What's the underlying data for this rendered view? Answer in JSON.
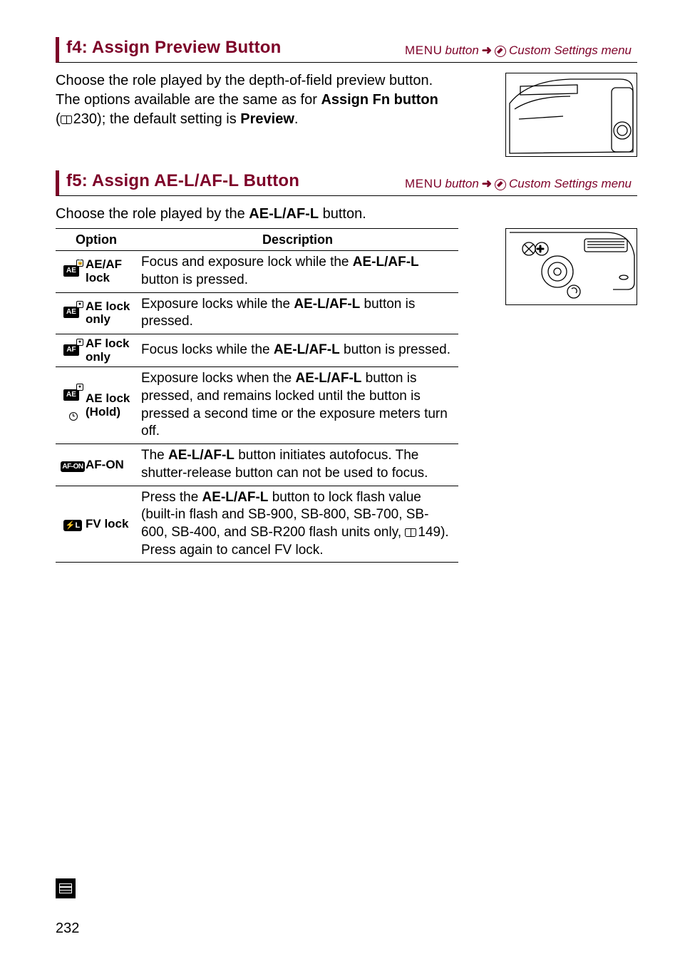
{
  "sections": {
    "f4": {
      "title": "f4: Assign Preview Button",
      "menu_btn": "MENU",
      "right_label": "Custom Settings menu",
      "para_before": "Choose the role played by the depth-of-field preview button. The options available are the same as for ",
      "bold1": "Assign Fn button",
      "para_mid": " ( 230); the default setting is ",
      "bold2": "Preview",
      "para_after": "."
    },
    "f5": {
      "title": "f5: Assign AE-L/AF-L Button",
      "menu_btn": "MENU",
      "right_label": "Custom Settings menu",
      "intro_before": "Choose the role played by the ",
      "intro_bold": "AE-L/AF-L",
      "intro_after": " button.",
      "th_option": "Option",
      "th_desc": "Description",
      "rows": [
        {
          "name": "AE/AF lock",
          "desc_before": "Focus and exposure lock while the ",
          "desc_bold": "AE-L/AF-L",
          "desc_after": " button is pressed."
        },
        {
          "name": "AE lock only",
          "desc_before": "Exposure locks while the ",
          "desc_bold": "AE-L/AF-L",
          "desc_after": " button is pressed."
        },
        {
          "name": "AF lock only",
          "desc_before": "Focus locks while the ",
          "desc_bold": "AE-L/AF-L",
          "desc_after": " button is pressed."
        },
        {
          "name": "AE lock (Hold)",
          "desc_before": "Exposure locks when the ",
          "desc_bold": "AE-L/AF-L",
          "desc_after": " button is pressed, and remains locked until the button is pressed a second time or the exposure meters turn off."
        },
        {
          "name": "AF-ON",
          "desc_before": "The ",
          "desc_bold": "AE-L/AF-L",
          "desc_after": " button initiates autofocus. The shutter-release button can not be used to focus."
        },
        {
          "name": "FV lock",
          "desc_before": "Press the ",
          "desc_bold": "AE-L/AF-L",
          "desc_after": " button to lock flash value (built-in flash and SB-900, SB-800, SB-700, SB-600, SB-400, and SB-R200 flash units only,  149).  Press again to cancel FV lock."
        }
      ]
    }
  },
  "page_number": "232"
}
